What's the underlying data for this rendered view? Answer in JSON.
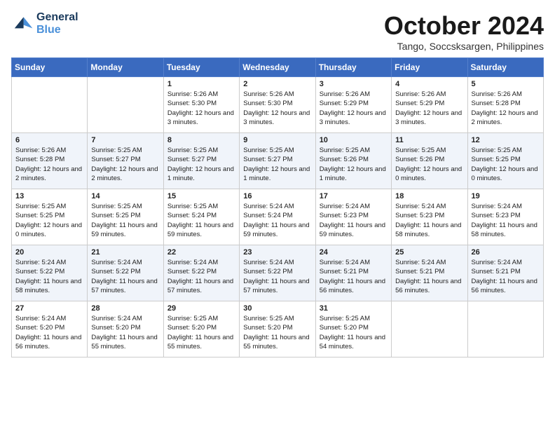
{
  "header": {
    "logo_line1": "General",
    "logo_line2": "Blue",
    "month": "October 2024",
    "location": "Tango, Soccsksargen, Philippines"
  },
  "weekdays": [
    "Sunday",
    "Monday",
    "Tuesday",
    "Wednesday",
    "Thursday",
    "Friday",
    "Saturday"
  ],
  "weeks": [
    [
      {
        "day": "",
        "sunrise": "",
        "sunset": "",
        "daylight": ""
      },
      {
        "day": "",
        "sunrise": "",
        "sunset": "",
        "daylight": ""
      },
      {
        "day": "1",
        "sunrise": "Sunrise: 5:26 AM",
        "sunset": "Sunset: 5:30 PM",
        "daylight": "Daylight: 12 hours and 3 minutes."
      },
      {
        "day": "2",
        "sunrise": "Sunrise: 5:26 AM",
        "sunset": "Sunset: 5:30 PM",
        "daylight": "Daylight: 12 hours and 3 minutes."
      },
      {
        "day": "3",
        "sunrise": "Sunrise: 5:26 AM",
        "sunset": "Sunset: 5:29 PM",
        "daylight": "Daylight: 12 hours and 3 minutes."
      },
      {
        "day": "4",
        "sunrise": "Sunrise: 5:26 AM",
        "sunset": "Sunset: 5:29 PM",
        "daylight": "Daylight: 12 hours and 3 minutes."
      },
      {
        "day": "5",
        "sunrise": "Sunrise: 5:26 AM",
        "sunset": "Sunset: 5:28 PM",
        "daylight": "Daylight: 12 hours and 2 minutes."
      }
    ],
    [
      {
        "day": "6",
        "sunrise": "Sunrise: 5:26 AM",
        "sunset": "Sunset: 5:28 PM",
        "daylight": "Daylight: 12 hours and 2 minutes."
      },
      {
        "day": "7",
        "sunrise": "Sunrise: 5:25 AM",
        "sunset": "Sunset: 5:27 PM",
        "daylight": "Daylight: 12 hours and 2 minutes."
      },
      {
        "day": "8",
        "sunrise": "Sunrise: 5:25 AM",
        "sunset": "Sunset: 5:27 PM",
        "daylight": "Daylight: 12 hours and 1 minute."
      },
      {
        "day": "9",
        "sunrise": "Sunrise: 5:25 AM",
        "sunset": "Sunset: 5:27 PM",
        "daylight": "Daylight: 12 hours and 1 minute."
      },
      {
        "day": "10",
        "sunrise": "Sunrise: 5:25 AM",
        "sunset": "Sunset: 5:26 PM",
        "daylight": "Daylight: 12 hours and 1 minute."
      },
      {
        "day": "11",
        "sunrise": "Sunrise: 5:25 AM",
        "sunset": "Sunset: 5:26 PM",
        "daylight": "Daylight: 12 hours and 0 minutes."
      },
      {
        "day": "12",
        "sunrise": "Sunrise: 5:25 AM",
        "sunset": "Sunset: 5:25 PM",
        "daylight": "Daylight: 12 hours and 0 minutes."
      }
    ],
    [
      {
        "day": "13",
        "sunrise": "Sunrise: 5:25 AM",
        "sunset": "Sunset: 5:25 PM",
        "daylight": "Daylight: 12 hours and 0 minutes."
      },
      {
        "day": "14",
        "sunrise": "Sunrise: 5:25 AM",
        "sunset": "Sunset: 5:25 PM",
        "daylight": "Daylight: 11 hours and 59 minutes."
      },
      {
        "day": "15",
        "sunrise": "Sunrise: 5:25 AM",
        "sunset": "Sunset: 5:24 PM",
        "daylight": "Daylight: 11 hours and 59 minutes."
      },
      {
        "day": "16",
        "sunrise": "Sunrise: 5:24 AM",
        "sunset": "Sunset: 5:24 PM",
        "daylight": "Daylight: 11 hours and 59 minutes."
      },
      {
        "day": "17",
        "sunrise": "Sunrise: 5:24 AM",
        "sunset": "Sunset: 5:23 PM",
        "daylight": "Daylight: 11 hours and 59 minutes."
      },
      {
        "day": "18",
        "sunrise": "Sunrise: 5:24 AM",
        "sunset": "Sunset: 5:23 PM",
        "daylight": "Daylight: 11 hours and 58 minutes."
      },
      {
        "day": "19",
        "sunrise": "Sunrise: 5:24 AM",
        "sunset": "Sunset: 5:23 PM",
        "daylight": "Daylight: 11 hours and 58 minutes."
      }
    ],
    [
      {
        "day": "20",
        "sunrise": "Sunrise: 5:24 AM",
        "sunset": "Sunset: 5:22 PM",
        "daylight": "Daylight: 11 hours and 58 minutes."
      },
      {
        "day": "21",
        "sunrise": "Sunrise: 5:24 AM",
        "sunset": "Sunset: 5:22 PM",
        "daylight": "Daylight: 11 hours and 57 minutes."
      },
      {
        "day": "22",
        "sunrise": "Sunrise: 5:24 AM",
        "sunset": "Sunset: 5:22 PM",
        "daylight": "Daylight: 11 hours and 57 minutes."
      },
      {
        "day": "23",
        "sunrise": "Sunrise: 5:24 AM",
        "sunset": "Sunset: 5:22 PM",
        "daylight": "Daylight: 11 hours and 57 minutes."
      },
      {
        "day": "24",
        "sunrise": "Sunrise: 5:24 AM",
        "sunset": "Sunset: 5:21 PM",
        "daylight": "Daylight: 11 hours and 56 minutes."
      },
      {
        "day": "25",
        "sunrise": "Sunrise: 5:24 AM",
        "sunset": "Sunset: 5:21 PM",
        "daylight": "Daylight: 11 hours and 56 minutes."
      },
      {
        "day": "26",
        "sunrise": "Sunrise: 5:24 AM",
        "sunset": "Sunset: 5:21 PM",
        "daylight": "Daylight: 11 hours and 56 minutes."
      }
    ],
    [
      {
        "day": "27",
        "sunrise": "Sunrise: 5:24 AM",
        "sunset": "Sunset: 5:20 PM",
        "daylight": "Daylight: 11 hours and 56 minutes."
      },
      {
        "day": "28",
        "sunrise": "Sunrise: 5:24 AM",
        "sunset": "Sunset: 5:20 PM",
        "daylight": "Daylight: 11 hours and 55 minutes."
      },
      {
        "day": "29",
        "sunrise": "Sunrise: 5:25 AM",
        "sunset": "Sunset: 5:20 PM",
        "daylight": "Daylight: 11 hours and 55 minutes."
      },
      {
        "day": "30",
        "sunrise": "Sunrise: 5:25 AM",
        "sunset": "Sunset: 5:20 PM",
        "daylight": "Daylight: 11 hours and 55 minutes."
      },
      {
        "day": "31",
        "sunrise": "Sunrise: 5:25 AM",
        "sunset": "Sunset: 5:20 PM",
        "daylight": "Daylight: 11 hours and 54 minutes."
      },
      {
        "day": "",
        "sunrise": "",
        "sunset": "",
        "daylight": ""
      },
      {
        "day": "",
        "sunrise": "",
        "sunset": "",
        "daylight": ""
      }
    ]
  ]
}
